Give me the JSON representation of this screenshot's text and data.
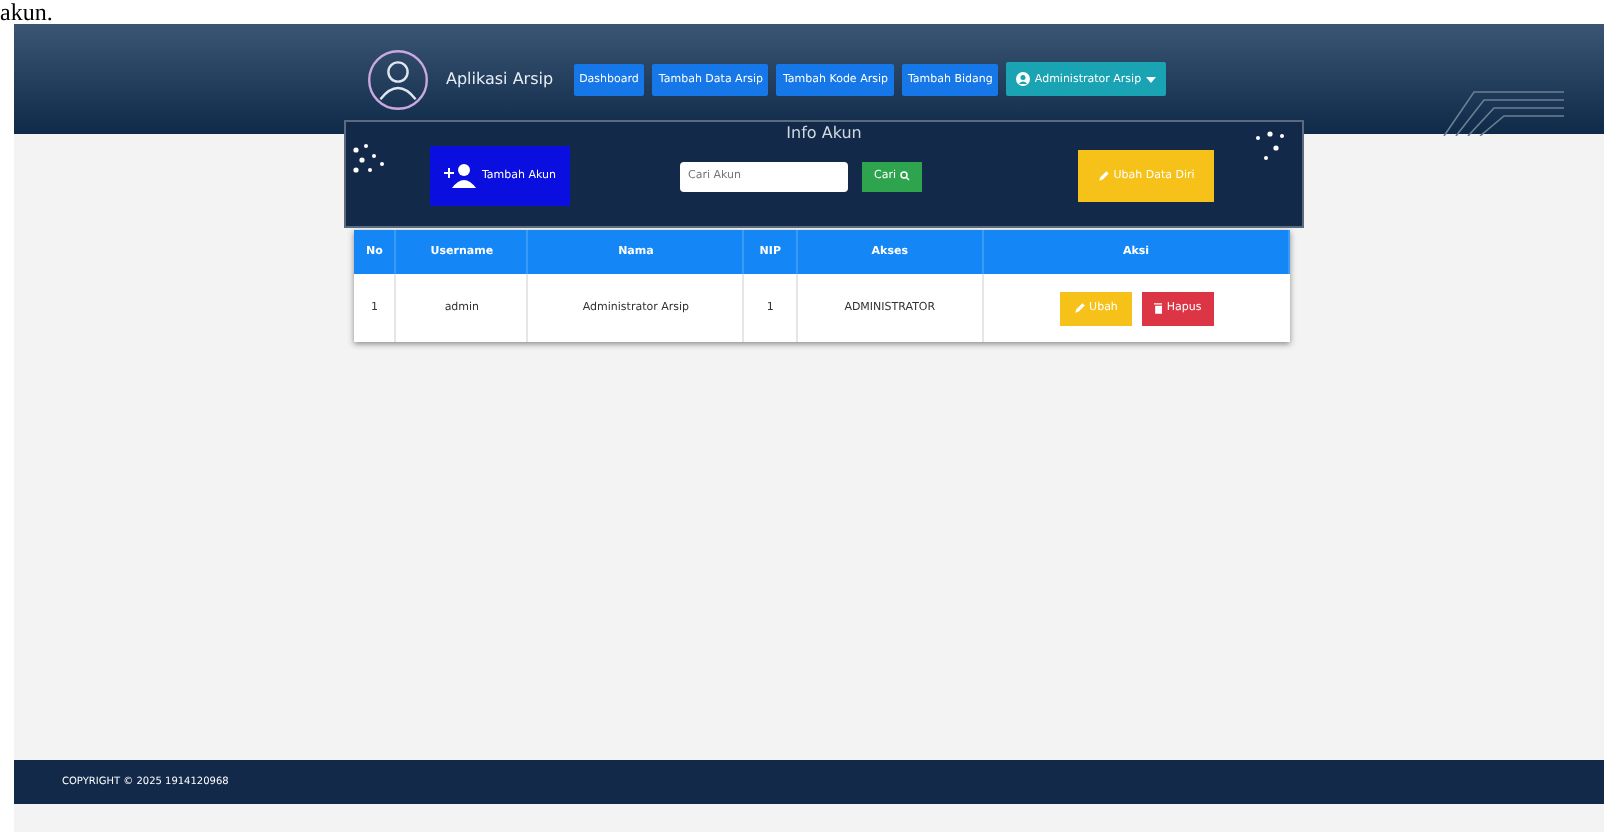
{
  "document_text": "akun.",
  "navbar": {
    "brand": "Aplikasi Arsip",
    "items": [
      {
        "label": "Dashboard",
        "kind": "link"
      },
      {
        "label": "Tambah Data Arsip",
        "kind": "link"
      },
      {
        "label": "Tambah Kode Arsip",
        "kind": "link"
      },
      {
        "label": "Tambah Bidang",
        "kind": "link"
      },
      {
        "label": "Administrator Arsip",
        "kind": "dropdown"
      }
    ]
  },
  "panel": {
    "title": "Info Akun",
    "add_button": "Tambah Akun",
    "search": {
      "placeholder": "Cari Akun"
    },
    "search_button": "Cari",
    "edit_self_button": "Ubah Data Diri"
  },
  "table": {
    "columns": [
      "No",
      "Username",
      "Nama",
      "NIP",
      "Akses",
      "Aksi"
    ],
    "rows": [
      {
        "cells": [
          "1",
          "admin",
          "Administrator Arsip",
          "1",
          "ADMINISTRATOR"
        ],
        "actions": [
          {
            "label": "Ubah",
            "kind": "edit"
          },
          {
            "label": "Hapus",
            "kind": "delete"
          }
        ]
      }
    ]
  },
  "footer": "COPYRIGHT © 2025 1914120968"
}
